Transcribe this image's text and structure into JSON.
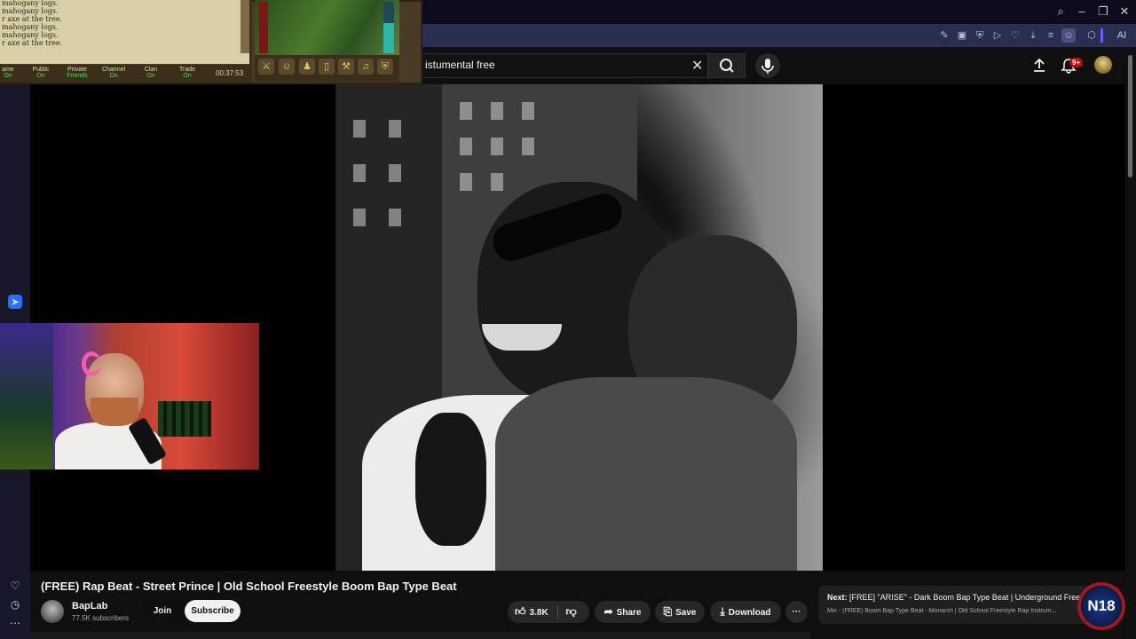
{
  "game": {
    "chat_lines": [
      "mahogany logs.",
      "mahogany logs.",
      "r axe at the tree.",
      "mahogany logs.",
      "mahogany logs.",
      "r axe at the tree."
    ],
    "tabs": [
      {
        "label": "ame",
        "status": "On"
      },
      {
        "label": "Public",
        "status": "On"
      },
      {
        "label": "Private",
        "status": "Friends"
      },
      {
        "label": "Channel",
        "status": "On"
      },
      {
        "label": "Clan",
        "status": "On"
      },
      {
        "label": "Trade",
        "status": "On"
      }
    ],
    "timer": "00:37:53"
  },
  "search": {
    "value": "istumental free"
  },
  "notifications": {
    "badge": "9+"
  },
  "video": {
    "title": "(FREE) Rap Beat - Street Prince | Old School Freestyle Boom Bap Type Beat"
  },
  "channel": {
    "name": "BapLab",
    "subscribers": "77.5K subscribers",
    "join_label": "Join",
    "subscribe_label": "Subscribe"
  },
  "actions": {
    "likes": "3.8K",
    "share_label": "Share",
    "save_label": "Save",
    "download_label": "Download",
    "more_label": "···"
  },
  "up_next": {
    "prefix": "Next:",
    "title": "[FREE] \"ARISE\" - Dark Boom Bap Type Beat | Underground Free...",
    "subtitle": "Mix - (FREE) Boom Bap Type Beat - Monarch | Old School Freestyle Rap Instrum..."
  },
  "overlay_logo": "N18",
  "browser": {
    "ai_label": "AI"
  },
  "colors": {
    "subscribe_bg": "#f1f1f1",
    "notification_badge": "#cc0000",
    "background": "#0f0f0f"
  },
  "icons": [
    "search-icon",
    "minimize-icon",
    "restore-icon",
    "close-icon",
    "mic-icon",
    "upload-icon",
    "bell-icon",
    "like-icon",
    "dislike-icon",
    "share-icon",
    "save-icon",
    "download-icon",
    "heart-icon",
    "clock-icon",
    "messenger-icon"
  ]
}
